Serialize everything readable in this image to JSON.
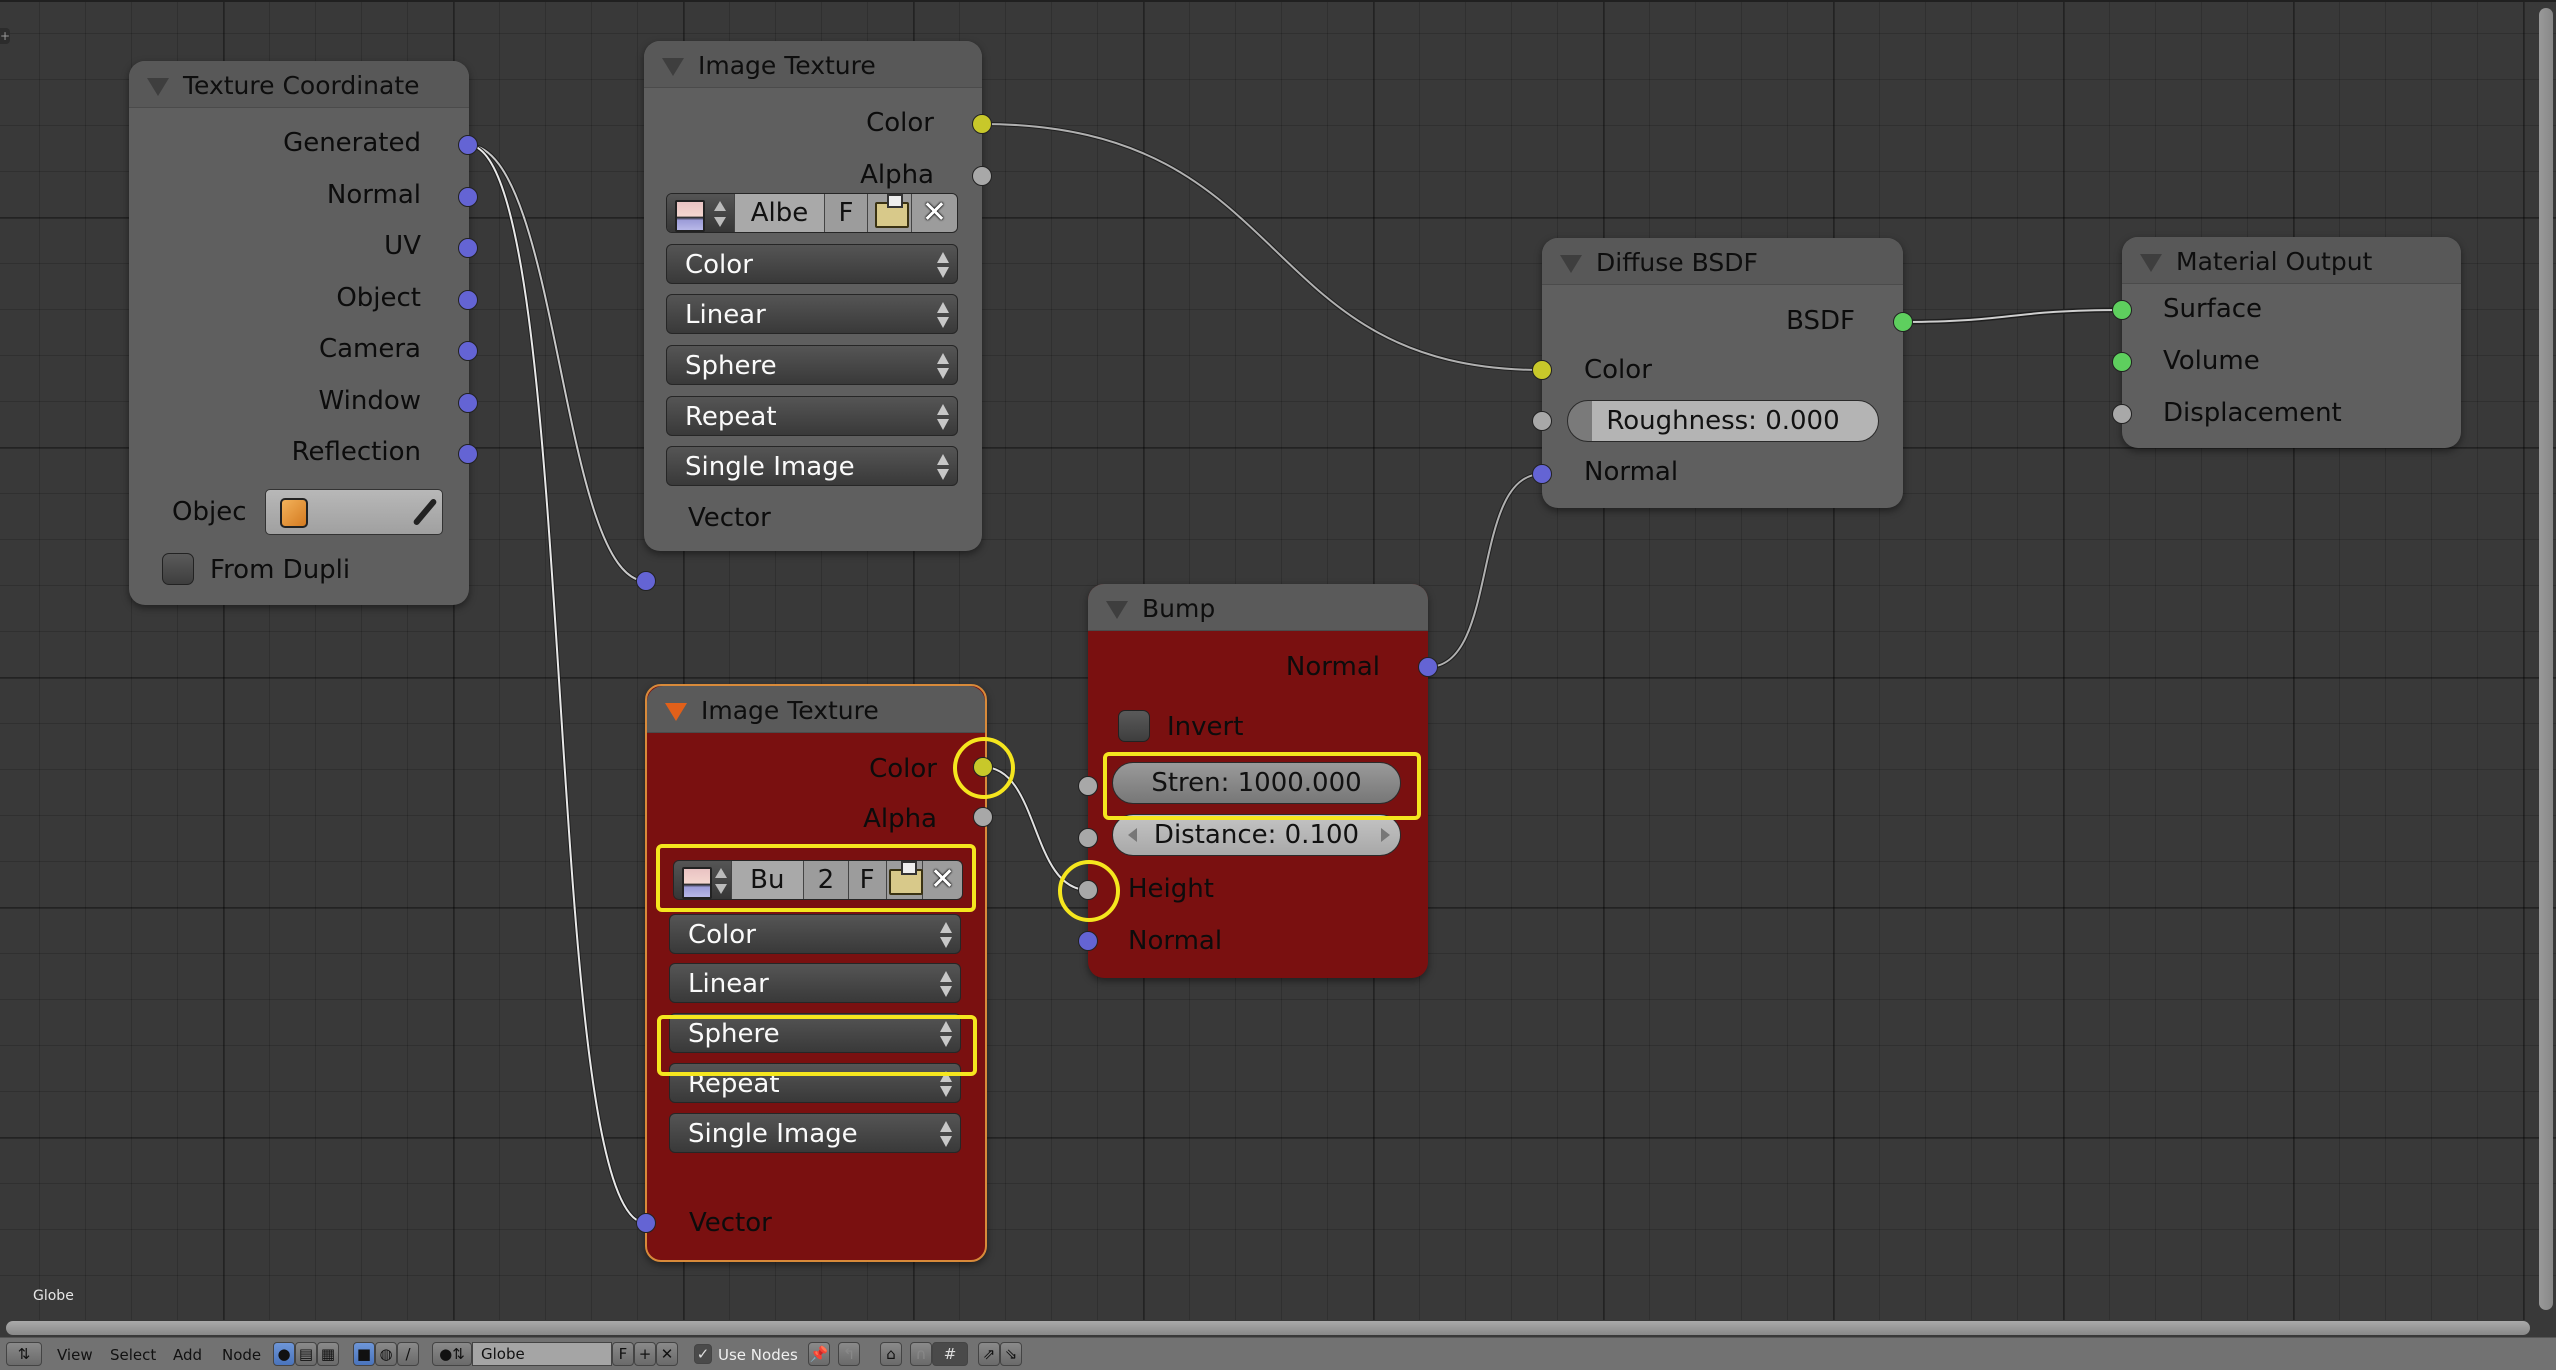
{
  "editor": {
    "context_label": "Globe",
    "header": {
      "menus": [
        "View",
        "Select",
        "Add",
        "Node"
      ],
      "material_name": "Globe",
      "fake_user_label": "F",
      "use_nodes_label": "Use Nodes",
      "use_nodes_checked": true
    }
  },
  "nodes": {
    "texture_coordinate": {
      "title": "Texture Coordinate",
      "outputs": [
        "Generated",
        "Normal",
        "UV",
        "Object",
        "Camera",
        "Window",
        "Reflection"
      ],
      "object_label": "Objec",
      "from_dupli_label": "From Dupli",
      "from_dupli_checked": false
    },
    "image_texture_top": {
      "title": "Image Texture",
      "outputs": [
        "Color",
        "Alpha"
      ],
      "image_name": "Albe",
      "fake_user": "F",
      "color_space": "Color",
      "interpolation": "Linear",
      "projection": "Sphere",
      "extension": "Repeat",
      "source": "Single Image",
      "input": "Vector"
    },
    "image_texture_bottom": {
      "title": "Image Texture",
      "outputs": [
        "Color",
        "Alpha"
      ],
      "image_name": "Bu",
      "users": "2",
      "fake_user": "F",
      "color_space": "Color",
      "interpolation": "Linear",
      "projection": "Sphere",
      "extension": "Repeat",
      "source": "Single Image",
      "input": "Vector"
    },
    "bump": {
      "title": "Bump",
      "output": "Normal",
      "invert_label": "Invert",
      "invert_checked": false,
      "strength": "Stren:  1000.000",
      "distance": "Distance:  0.100",
      "inputs": [
        "Height",
        "Normal"
      ]
    },
    "diffuse_bsdf": {
      "title": "Diffuse BSDF",
      "output": "BSDF",
      "inputs": [
        "Color",
        "Normal"
      ],
      "roughness": "Roughness:  0.000"
    },
    "material_output": {
      "title": "Material Output",
      "inputs": [
        "Surface",
        "Volume",
        "Displacement"
      ]
    }
  },
  "links": [
    {
      "from": "texture_coordinate.Generated",
      "to": "image_texture_top.Vector"
    },
    {
      "from": "texture_coordinate.Generated",
      "to": "image_texture_bottom.Vector"
    },
    {
      "from": "image_texture_top.Color",
      "to": "diffuse_bsdf.Color"
    },
    {
      "from": "image_texture_bottom.Color",
      "to": "bump.Height"
    },
    {
      "from": "bump.Normal",
      "to": "diffuse_bsdf.Normal"
    },
    {
      "from": "diffuse_bsdf.BSDF",
      "to": "material_output.Surface"
    }
  ],
  "colors": {
    "socket_vector": "#6464d4",
    "socket_color": "#c8c82a",
    "socket_value": "#a8a8a8",
    "socket_shader": "#5ecf5e",
    "selected_node": "#7a1010",
    "highlight": "#f5e61e"
  }
}
